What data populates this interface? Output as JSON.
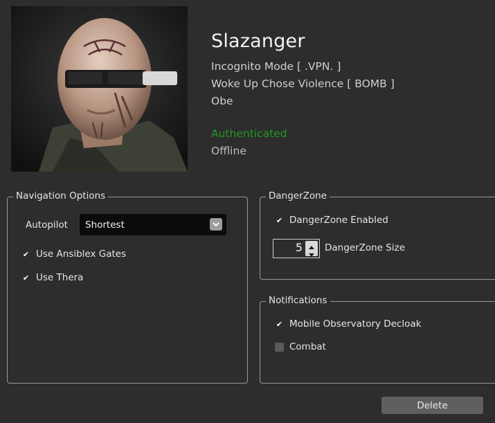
{
  "character": {
    "name": "Slazanger",
    "corporation": "Incognito Mode  [ .VPN. ]",
    "alliance": "Woke Up Chose Violence  [ BOMB ]",
    "location": "Obe",
    "auth_status": "Authenticated",
    "online_status": "Offline"
  },
  "navigation": {
    "title": "Navigation Options",
    "autopilot_label": "Autopilot",
    "autopilot_value": "Shortest",
    "use_ansiblex_label": "Use Ansiblex Gates",
    "use_ansiblex_checked": true,
    "use_thera_label": "Use Thera",
    "use_thera_checked": true
  },
  "dangerzone": {
    "title": "DangerZone",
    "enabled_label": "DangerZone Enabled",
    "enabled_checked": true,
    "size_value": "5",
    "size_label": "DangerZone Size"
  },
  "notifications": {
    "title": "Notifications",
    "mobile_observatory_label": "Mobile Observatory Decloak",
    "mobile_observatory_checked": true,
    "combat_label": "Combat",
    "combat_checked": false
  },
  "actions": {
    "delete_label": "Delete"
  },
  "colors": {
    "background": "#2d2d2d",
    "authenticated": "#1f9a1f",
    "button": "#5f5f5f",
    "select_bg": "#0b0b0b"
  }
}
